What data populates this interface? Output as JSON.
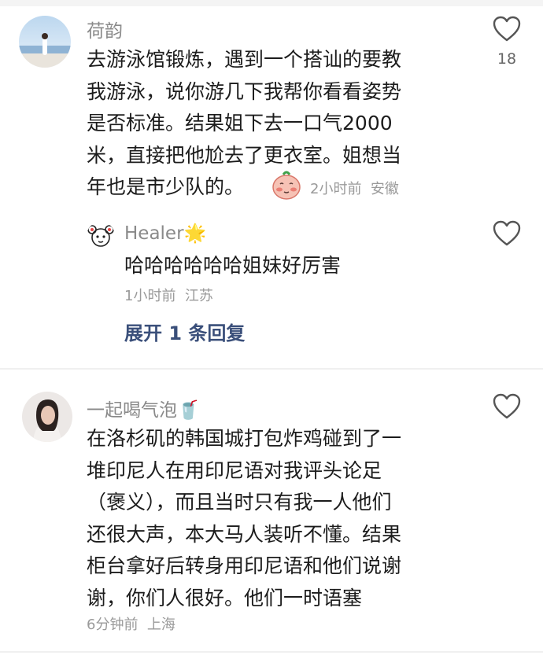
{
  "comments": [
    {
      "author": "荷韵",
      "text": "去游泳馆锻炼，遇到一个搭讪的要教\n我游泳，说你游几下我帮你看看姿势\n是否标准。结果姐下去一口气2000\n米，直接把他尬去了更衣室。姐想当\n年也是市少队的。",
      "sticker": "blushing-face-sticker",
      "time": "2小时前",
      "location": "安徽",
      "likes": "18"
    },
    {
      "author": "Healer",
      "author_emoji": "🌟",
      "text": "哈哈哈哈哈哈姐妹好厉害",
      "time": "1小时前",
      "location": "江苏",
      "expand_label": "展开 1 条回复"
    },
    {
      "author": "一起喝气泡",
      "author_emoji": "🥤",
      "text": "在洛杉矶的韩国城打包炸鸡碰到了一\n堆印尼人在用印尼语对我评头论足\n（褒义），而且当时只有我一人他们\n还很大声，本大马人装听不懂。结果\n柜台拿好后转身用印尼语和他们说谢\n谢，你们人很好。他们一时语塞",
      "time": "6分钟前",
      "location": "上海"
    }
  ]
}
